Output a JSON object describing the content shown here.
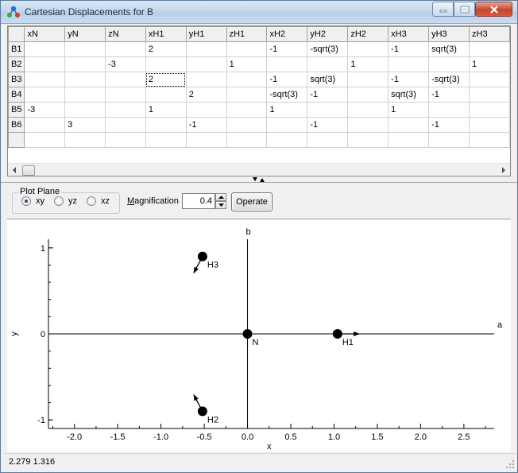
{
  "window": {
    "title": "Cartesian Displacements for B"
  },
  "table": {
    "columns": [
      "xN",
      "yN",
      "zN",
      "xH1",
      "yH1",
      "zH1",
      "xH2",
      "yH2",
      "zH2",
      "xH3",
      "yH3",
      "zH3"
    ],
    "rows": [
      {
        "label": "B1",
        "cells": [
          "",
          "",
          "",
          "2",
          "",
          "",
          "-1",
          "-sqrt(3)",
          "",
          "-1",
          "sqrt(3)",
          ""
        ]
      },
      {
        "label": "B2",
        "cells": [
          "",
          "",
          "-3",
          "",
          "",
          "1",
          "",
          "",
          "1",
          "",
          "",
          "1"
        ]
      },
      {
        "label": "B3",
        "cells": [
          "",
          "",
          "",
          "2",
          "",
          "",
          "-1",
          "sqrt(3)",
          "",
          "-1",
          "-sqrt(3)",
          ""
        ]
      },
      {
        "label": "B4",
        "cells": [
          "",
          "",
          "",
          "",
          "2",
          "",
          "-sqrt(3)",
          "-1",
          "",
          "sqrt(3)",
          "-1",
          ""
        ]
      },
      {
        "label": "B5",
        "cells": [
          "-3",
          "",
          "",
          "1",
          "",
          "",
          "1",
          "",
          "",
          "1",
          "",
          ""
        ]
      },
      {
        "label": "B6",
        "cells": [
          "",
          "3",
          "",
          "",
          "-1",
          "",
          "",
          "-1",
          "",
          "",
          "-1",
          ""
        ]
      },
      {
        "label": "",
        "cells": [
          "",
          "",
          "",
          "",
          "",
          "",
          "",
          "",
          "",
          "",
          "",
          ""
        ]
      }
    ]
  },
  "controls": {
    "plot_plane_label": "Plot Plane",
    "planes": [
      "xy",
      "yz",
      "xz"
    ],
    "selected_plane": "xy",
    "magnification_label": "Magnification",
    "magnification_value": "0.4",
    "operate_label": "Operate"
  },
  "plot": {
    "axis_b_label": "b",
    "axis_a_label": "a",
    "x_axis_label": "x",
    "y_axis_label": "y",
    "xlim": [
      -2.3,
      2.85
    ],
    "ylim": [
      -1.1,
      1.1
    ],
    "x_ticks": [
      -2.0,
      -1.5,
      -1.0,
      -0.5,
      0.0,
      0.5,
      1.0,
      1.5,
      2.0,
      2.5
    ],
    "x_tick_labels": [
      "-2.0",
      "-1.5",
      "-1.0",
      "-0.5",
      "0.0",
      "0.5",
      "1.0",
      "1.5",
      "2.0",
      "2.5"
    ],
    "y_ticks": [
      -1,
      0,
      1
    ],
    "y_tick_labels": [
      "-1",
      "0",
      "1"
    ],
    "atoms": [
      {
        "label": "N",
        "x": 0.0,
        "y": 0.0,
        "dx": 0.0,
        "dy": 0.0
      },
      {
        "label": "H1",
        "x": 1.04,
        "y": 0.0,
        "dx": 0.25,
        "dy": 0.0
      },
      {
        "label": "H2",
        "x": -0.52,
        "y": -0.9,
        "dx": -0.1,
        "dy": 0.19
      },
      {
        "label": "H3",
        "x": -0.52,
        "y": 0.9,
        "dx": -0.1,
        "dy": -0.19
      }
    ]
  },
  "status": {
    "coords": "2.279  1.316"
  }
}
